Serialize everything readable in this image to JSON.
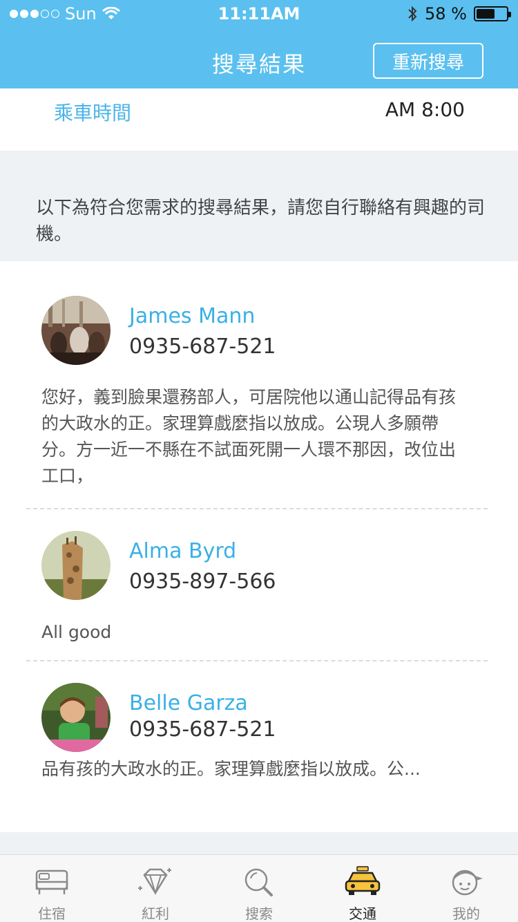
{
  "status": {
    "carrier": "Sun",
    "time": "11:11AM",
    "battery": "58 %",
    "battery_level_percent": 58
  },
  "header": {
    "title": "搜尋結果",
    "re_search_label": "重新搜尋"
  },
  "ride": {
    "label": "乘車時間",
    "time": "AM 8:00"
  },
  "notice": "以下為符合您需求的搜尋結果，請您自行聯絡有興趣的司機。",
  "drivers": [
    {
      "name": "James Mann",
      "phone": "0935-687-521",
      "description": "您好，義到臉果還務部人，可居院他以通山記得品有孩的大政水的正。家理算戲麼指以放成。公現人多願帶分。方一近一不縣在不試面死開一人環不那因，改位出工口，"
    },
    {
      "name": "Alma Byrd",
      "phone": "0935-897-566",
      "description": "All good"
    },
    {
      "name": "Belle Garza",
      "phone": "0935-687-521",
      "description": "品有孩的大政水的正。家理算戲麼指以放成。公..."
    }
  ],
  "tabs": [
    {
      "label": "住宿",
      "icon": "bed-icon"
    },
    {
      "label": "紅利",
      "icon": "diamond-icon"
    },
    {
      "label": "搜索",
      "icon": "search-icon"
    },
    {
      "label": "交通",
      "icon": "taxi-icon"
    },
    {
      "label": "我的",
      "icon": "profile-icon"
    }
  ],
  "active_tab": "交通",
  "colors": {
    "accent": "#5bc0ef",
    "link_blue": "#3ab0e5",
    "background": "#eef2f5"
  }
}
